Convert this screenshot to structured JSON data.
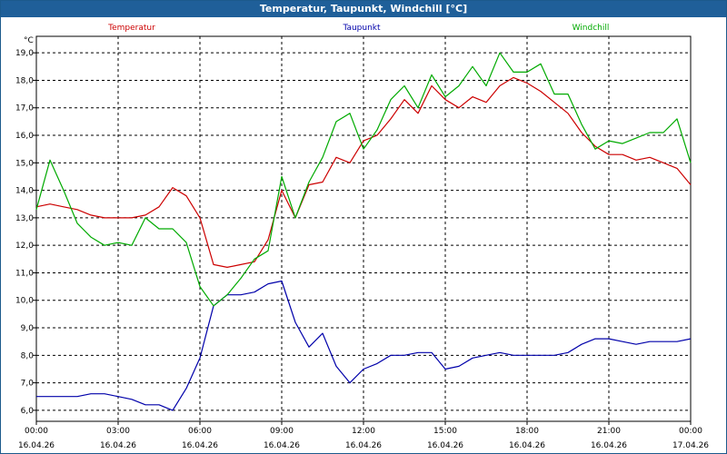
{
  "window": {
    "title": "Temperatur, Taupunkt, Windchill [°C]"
  },
  "chart_data": {
    "type": "line",
    "title": "Temperatur, Taupunkt, Windchill [°C]",
    "ylabel": "°C",
    "ylim": [
      5.6,
      19.6
    ],
    "xlim": [
      0,
      24
    ],
    "grid": true,
    "legend_placement": "top",
    "y_ticks": [
      "6,0",
      "7,0",
      "8,0",
      "9,0",
      "10,0",
      "11,0",
      "12,0",
      "13,0",
      "14,0",
      "15,0",
      "16,0",
      "17,0",
      "18,0",
      "19,0"
    ],
    "x_ticks": [
      {
        "time": "00:00",
        "date": "16.04.26"
      },
      {
        "time": "03:00",
        "date": "16.04.26"
      },
      {
        "time": "06:00",
        "date": "16.04.26"
      },
      {
        "time": "09:00",
        "date": "16.04.26"
      },
      {
        "time": "12:00",
        "date": "16.04.26"
      },
      {
        "time": "15:00",
        "date": "16.04.26"
      },
      {
        "time": "18:00",
        "date": "16.04.26"
      },
      {
        "time": "21:00",
        "date": "16.04.26"
      },
      {
        "time": "00:00",
        "date": "17.04.26"
      }
    ],
    "x_hours": [
      0,
      0.5,
      1,
      1.5,
      2,
      2.5,
      3,
      3.5,
      4,
      4.5,
      5,
      5.5,
      6,
      6.5,
      7,
      7.5,
      8,
      8.5,
      9,
      9.5,
      10,
      10.5,
      11,
      11.5,
      12,
      12.5,
      13,
      13.5,
      14,
      14.5,
      15,
      15.5,
      16,
      16.5,
      17,
      17.5,
      18,
      18.5,
      19,
      19.5,
      20,
      20.5,
      21,
      21.5,
      22,
      22.5,
      23,
      23.5,
      24
    ],
    "series": [
      {
        "name": "Temperatur",
        "color": "#cc0000",
        "values": [
          13.4,
          13.5,
          13.4,
          13.3,
          13.1,
          13.0,
          13.0,
          13.0,
          13.1,
          13.4,
          14.1,
          13.8,
          13.0,
          11.3,
          11.2,
          11.3,
          11.4,
          12.2,
          14.0,
          13.0,
          14.2,
          14.3,
          15.2,
          15.0,
          15.8,
          16.0,
          16.6,
          17.3,
          16.8,
          17.8,
          17.3,
          17.0,
          17.4,
          17.2,
          17.8,
          18.1,
          17.9,
          17.6,
          17.2,
          16.8,
          16.1,
          15.6,
          15.3,
          15.3,
          15.1,
          15.2,
          15.0,
          14.8,
          14.2
        ]
      },
      {
        "name": "Taupunkt",
        "color": "#0000aa",
        "values": [
          6.5,
          6.5,
          6.5,
          6.5,
          6.6,
          6.6,
          6.5,
          6.4,
          6.2,
          6.2,
          6.0,
          6.8,
          7.9,
          9.8,
          10.2,
          10.2,
          10.3,
          10.6,
          10.7,
          9.2,
          8.3,
          8.8,
          7.6,
          7.0,
          7.5,
          7.7,
          8.0,
          8.0,
          8.1,
          8.1,
          7.5,
          7.6,
          7.9,
          8.0,
          8.1,
          8.0,
          8.0,
          8.0,
          8.0,
          8.1,
          8.4,
          8.6,
          8.6,
          8.5,
          8.4,
          8.5,
          8.5,
          8.5,
          8.6
        ]
      },
      {
        "name": "Windchill",
        "color": "#00aa00",
        "values": [
          13.3,
          15.1,
          14.0,
          12.8,
          12.3,
          12.0,
          12.1,
          12.0,
          13.0,
          12.6,
          12.6,
          12.1,
          10.5,
          9.8,
          10.2,
          10.8,
          11.5,
          11.8,
          14.5,
          13.0,
          14.3,
          15.2,
          16.5,
          16.8,
          15.5,
          16.2,
          17.3,
          17.8,
          17.0,
          18.2,
          17.4,
          17.8,
          18.5,
          17.8,
          19.0,
          18.3,
          18.3,
          18.6,
          17.5,
          17.5,
          16.4,
          15.5,
          15.8,
          15.7,
          15.9,
          16.1,
          16.1,
          16.6,
          15.0
        ]
      }
    ]
  }
}
